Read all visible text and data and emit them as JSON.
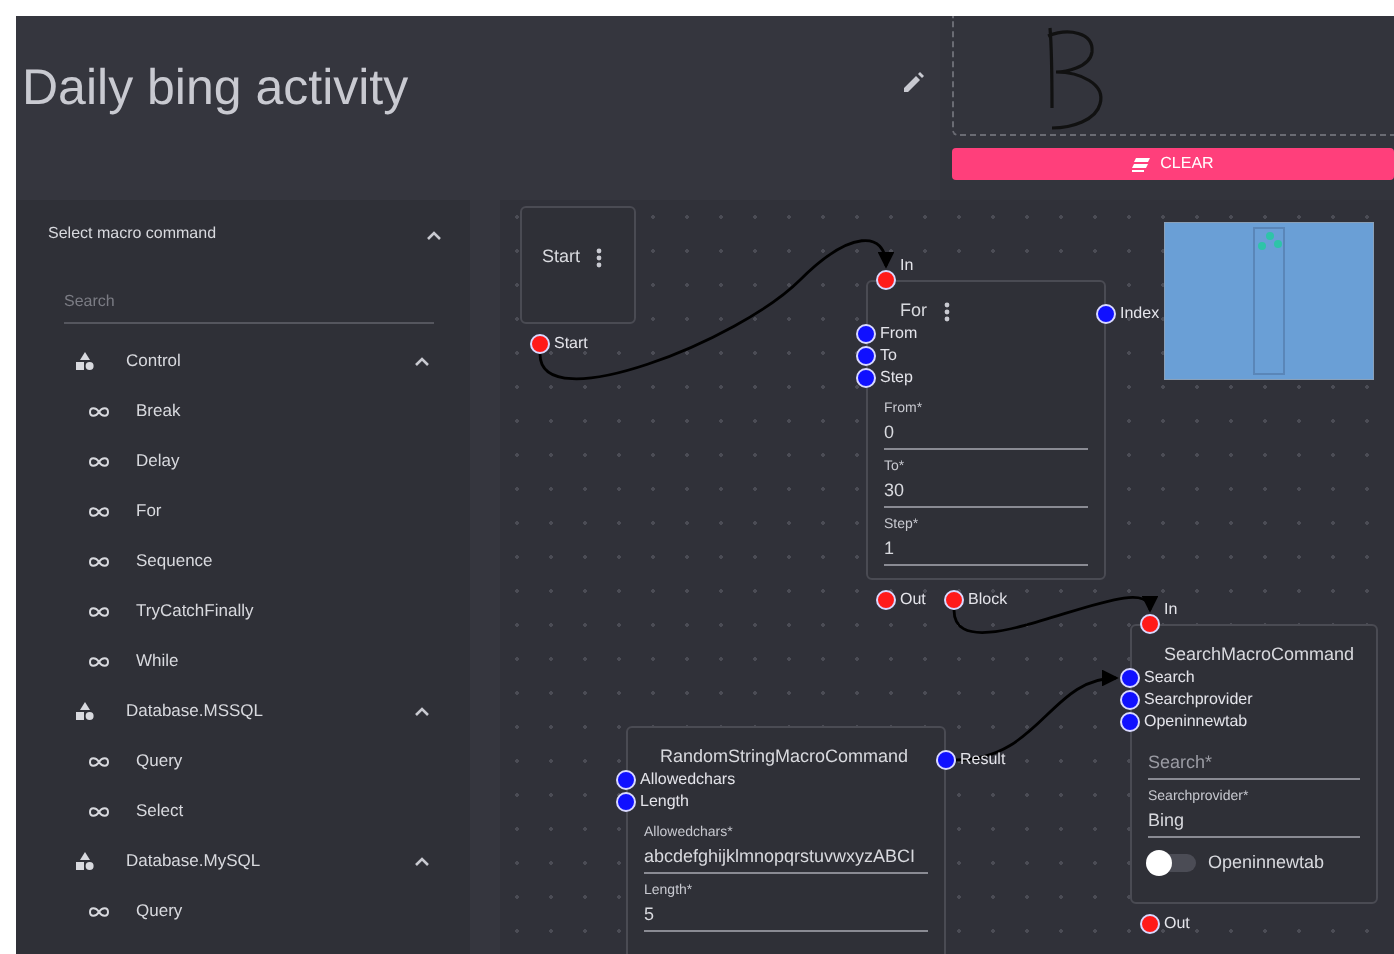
{
  "title": "Daily bing activity",
  "signature": {
    "button": "CLEAR"
  },
  "sidebar": {
    "header": "Select macro command",
    "expanded": true,
    "search": {
      "placeholder": "Search"
    },
    "groups": [
      {
        "label": "Control",
        "expanded": true,
        "items": [
          "Break",
          "Delay",
          "For",
          "Sequence",
          "TryCatchFinally",
          "While"
        ]
      },
      {
        "label": "Database.MSSQL",
        "expanded": true,
        "items": [
          "Query",
          "Select"
        ]
      },
      {
        "label": "Database.MySQL",
        "expanded": true,
        "items": [
          "Query"
        ]
      }
    ]
  },
  "canvas": {
    "nodes": [
      {
        "title": "Start",
        "flow_out": [
          "Start"
        ]
      },
      {
        "title": "For",
        "flow_in": "In",
        "inputs": [
          "From",
          "To",
          "Step"
        ],
        "outputs": [
          "Index"
        ],
        "flow_out": [
          "Out",
          "Block"
        ],
        "fields": [
          {
            "kind": "text",
            "label": "From*",
            "value": "0"
          },
          {
            "kind": "text",
            "label": "To*",
            "value": "30"
          },
          {
            "kind": "text",
            "label": "Step*",
            "value": "1"
          }
        ]
      },
      {
        "title": "RandomStringMacroCommand",
        "inputs": [
          "Allowedchars",
          "Length"
        ],
        "outputs": [
          "Result"
        ],
        "fields": [
          {
            "kind": "text",
            "label": "Allowedchars*",
            "value": "abcdefghijklmnopqrstuvwxyzABCI"
          },
          {
            "kind": "text",
            "label": "Length*",
            "value": "5"
          }
        ]
      },
      {
        "title": "SearchMacroCommand",
        "flow_in": "In",
        "inputs": [
          "Search",
          "Searchprovider",
          "Openinnewtab"
        ],
        "flow_out": [
          "Out"
        ],
        "fields": [
          {
            "kind": "empty",
            "placeholder": "Search*"
          },
          {
            "kind": "text",
            "label": "Searchprovider*",
            "value": "Bing"
          },
          {
            "kind": "toggle",
            "label": "Openinnewtab",
            "on": false
          }
        ]
      }
    ]
  }
}
